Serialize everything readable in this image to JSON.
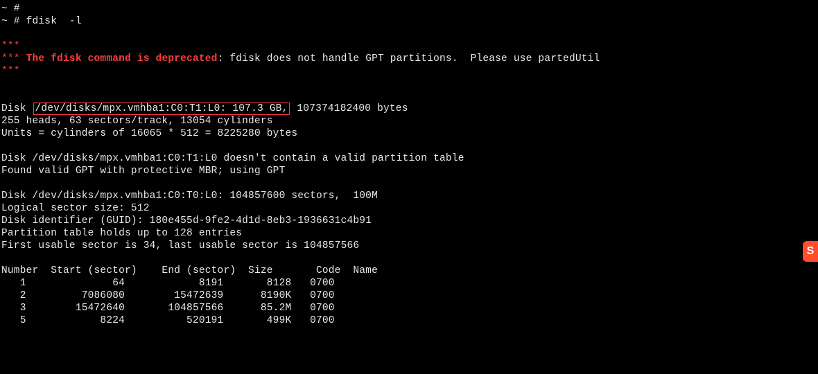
{
  "prompt1": "~ #",
  "prompt2": "~ # fdisk  -l",
  "stars": "***",
  "deprecated_prefix": "*** ",
  "deprecated_bold": "The fdisk command is deprecated",
  "deprecated_rest": ": fdisk does not handle GPT partitions.  Please use partedUtil",
  "disk_line_prefix": "Disk ",
  "disk_highlight": "/dev/disks/mpx.vmhba1:C0:T1:L0: 107.3 GB,",
  "disk_line_suffix": " 107374182400 bytes",
  "heads_line": "255 heads, 63 sectors/track, 13054 cylinders",
  "units_line": "Units = cylinders of 16065 * 512 = 8225280 bytes",
  "no_table_line": "Disk /dev/disks/mpx.vmhba1:C0:T1:L0 doesn't contain a valid partition table",
  "found_gpt_line": "Found valid GPT with protective MBR; using GPT",
  "disk2_line": "Disk /dev/disks/mpx.vmhba1:C0:T0:L0: 104857600 sectors,  100M",
  "logical_line": "Logical sector size: 512",
  "guid_line": "Disk identifier (GUID): 180e455d-9fe2-4d1d-8eb3-1936631c4b91",
  "entries_line": "Partition table holds up to 128 entries",
  "usable_line": "First usable sector is 34, last usable sector is 104857566",
  "table_header": "Number  Start (sector)    End (sector)  Size       Code  Name",
  "row1": "   1              64            8191       8128   0700  ",
  "row2": "   2         7086080        15472639      8190K   0700  ",
  "row3": "   3        15472640       104857566      85.2M   0700  ",
  "row4": "   5            8224          520191       499K   0700  ",
  "badge": "S"
}
